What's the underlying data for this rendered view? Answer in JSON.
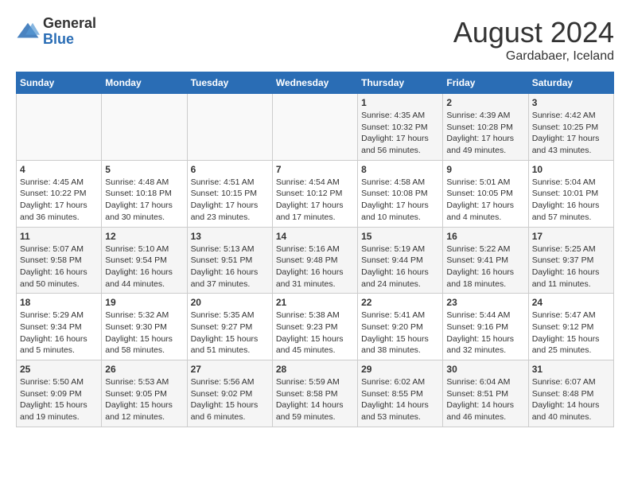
{
  "header": {
    "logo_general": "General",
    "logo_blue": "Blue",
    "month_year": "August 2024",
    "location": "Gardabaer, Iceland"
  },
  "calendar": {
    "days_of_week": [
      "Sunday",
      "Monday",
      "Tuesday",
      "Wednesday",
      "Thursday",
      "Friday",
      "Saturday"
    ],
    "weeks": [
      [
        {
          "day": "",
          "info": ""
        },
        {
          "day": "",
          "info": ""
        },
        {
          "day": "",
          "info": ""
        },
        {
          "day": "",
          "info": ""
        },
        {
          "day": "1",
          "info": "Sunrise: 4:35 AM\nSunset: 10:32 PM\nDaylight: 17 hours\nand 56 minutes."
        },
        {
          "day": "2",
          "info": "Sunrise: 4:39 AM\nSunset: 10:28 PM\nDaylight: 17 hours\nand 49 minutes."
        },
        {
          "day": "3",
          "info": "Sunrise: 4:42 AM\nSunset: 10:25 PM\nDaylight: 17 hours\nand 43 minutes."
        }
      ],
      [
        {
          "day": "4",
          "info": "Sunrise: 4:45 AM\nSunset: 10:22 PM\nDaylight: 17 hours\nand 36 minutes."
        },
        {
          "day": "5",
          "info": "Sunrise: 4:48 AM\nSunset: 10:18 PM\nDaylight: 17 hours\nand 30 minutes."
        },
        {
          "day": "6",
          "info": "Sunrise: 4:51 AM\nSunset: 10:15 PM\nDaylight: 17 hours\nand 23 minutes."
        },
        {
          "day": "7",
          "info": "Sunrise: 4:54 AM\nSunset: 10:12 PM\nDaylight: 17 hours\nand 17 minutes."
        },
        {
          "day": "8",
          "info": "Sunrise: 4:58 AM\nSunset: 10:08 PM\nDaylight: 17 hours\nand 10 minutes."
        },
        {
          "day": "9",
          "info": "Sunrise: 5:01 AM\nSunset: 10:05 PM\nDaylight: 17 hours\nand 4 minutes."
        },
        {
          "day": "10",
          "info": "Sunrise: 5:04 AM\nSunset: 10:01 PM\nDaylight: 16 hours\nand 57 minutes."
        }
      ],
      [
        {
          "day": "11",
          "info": "Sunrise: 5:07 AM\nSunset: 9:58 PM\nDaylight: 16 hours\nand 50 minutes."
        },
        {
          "day": "12",
          "info": "Sunrise: 5:10 AM\nSunset: 9:54 PM\nDaylight: 16 hours\nand 44 minutes."
        },
        {
          "day": "13",
          "info": "Sunrise: 5:13 AM\nSunset: 9:51 PM\nDaylight: 16 hours\nand 37 minutes."
        },
        {
          "day": "14",
          "info": "Sunrise: 5:16 AM\nSunset: 9:48 PM\nDaylight: 16 hours\nand 31 minutes."
        },
        {
          "day": "15",
          "info": "Sunrise: 5:19 AM\nSunset: 9:44 PM\nDaylight: 16 hours\nand 24 minutes."
        },
        {
          "day": "16",
          "info": "Sunrise: 5:22 AM\nSunset: 9:41 PM\nDaylight: 16 hours\nand 18 minutes."
        },
        {
          "day": "17",
          "info": "Sunrise: 5:25 AM\nSunset: 9:37 PM\nDaylight: 16 hours\nand 11 minutes."
        }
      ],
      [
        {
          "day": "18",
          "info": "Sunrise: 5:29 AM\nSunset: 9:34 PM\nDaylight: 16 hours\nand 5 minutes."
        },
        {
          "day": "19",
          "info": "Sunrise: 5:32 AM\nSunset: 9:30 PM\nDaylight: 15 hours\nand 58 minutes."
        },
        {
          "day": "20",
          "info": "Sunrise: 5:35 AM\nSunset: 9:27 PM\nDaylight: 15 hours\nand 51 minutes."
        },
        {
          "day": "21",
          "info": "Sunrise: 5:38 AM\nSunset: 9:23 PM\nDaylight: 15 hours\nand 45 minutes."
        },
        {
          "day": "22",
          "info": "Sunrise: 5:41 AM\nSunset: 9:20 PM\nDaylight: 15 hours\nand 38 minutes."
        },
        {
          "day": "23",
          "info": "Sunrise: 5:44 AM\nSunset: 9:16 PM\nDaylight: 15 hours\nand 32 minutes."
        },
        {
          "day": "24",
          "info": "Sunrise: 5:47 AM\nSunset: 9:12 PM\nDaylight: 15 hours\nand 25 minutes."
        }
      ],
      [
        {
          "day": "25",
          "info": "Sunrise: 5:50 AM\nSunset: 9:09 PM\nDaylight: 15 hours\nand 19 minutes."
        },
        {
          "day": "26",
          "info": "Sunrise: 5:53 AM\nSunset: 9:05 PM\nDaylight: 15 hours\nand 12 minutes."
        },
        {
          "day": "27",
          "info": "Sunrise: 5:56 AM\nSunset: 9:02 PM\nDaylight: 15 hours\nand 6 minutes."
        },
        {
          "day": "28",
          "info": "Sunrise: 5:59 AM\nSunset: 8:58 PM\nDaylight: 14 hours\nand 59 minutes."
        },
        {
          "day": "29",
          "info": "Sunrise: 6:02 AM\nSunset: 8:55 PM\nDaylight: 14 hours\nand 53 minutes."
        },
        {
          "day": "30",
          "info": "Sunrise: 6:04 AM\nSunset: 8:51 PM\nDaylight: 14 hours\nand 46 minutes."
        },
        {
          "day": "31",
          "info": "Sunrise: 6:07 AM\nSunset: 8:48 PM\nDaylight: 14 hours\nand 40 minutes."
        }
      ]
    ]
  }
}
